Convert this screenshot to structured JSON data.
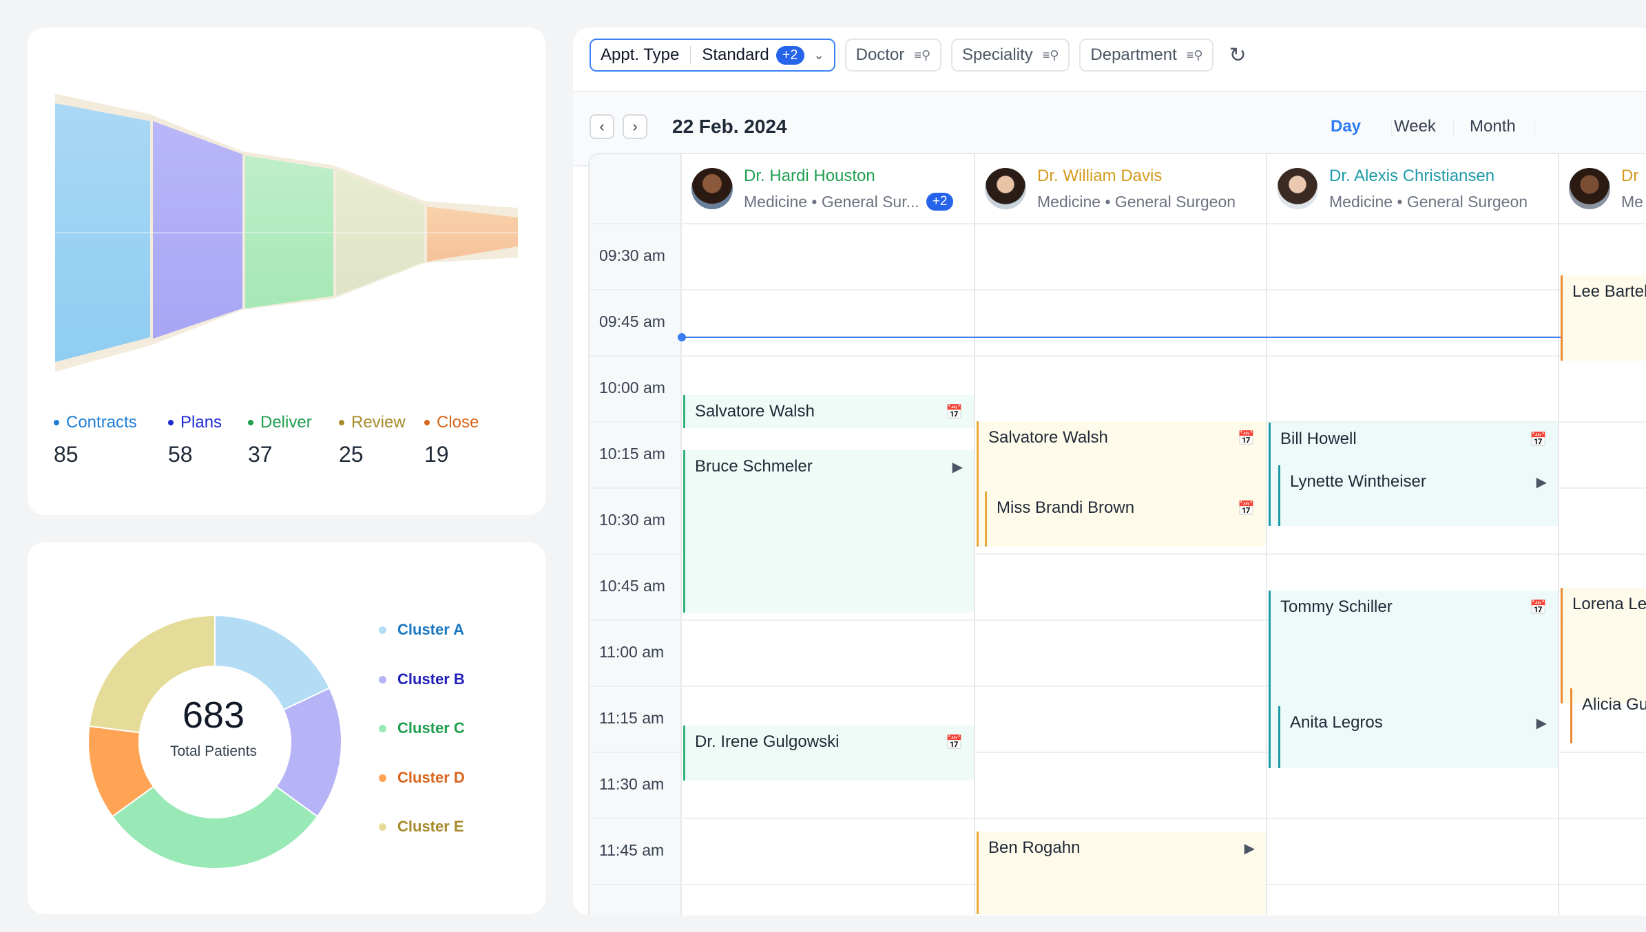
{
  "funnel": {
    "stages": [
      {
        "label": "Contracts",
        "value": "85",
        "color": "#1f7fd6"
      },
      {
        "label": "Plans",
        "value": "58",
        "color": "#1b2bd0"
      },
      {
        "label": "Deliver",
        "value": "37",
        "color": "#1f9e4f"
      },
      {
        "label": "Review",
        "value": "25",
        "color": "#a68a2b"
      },
      {
        "label": "Close",
        "value": "19",
        "color": "#d9641b"
      }
    ]
  },
  "donut": {
    "total": "683",
    "total_label": "Total Patients",
    "clusters": [
      {
        "label": "Cluster A",
        "value": 18,
        "color": "#b3dcf5",
        "text": "#1a78c2"
      },
      {
        "label": "Cluster B",
        "value": 17,
        "color": "#b6b4f7",
        "text": "#2020b8"
      },
      {
        "label": "Cluster C",
        "value": 30,
        "color": "#98e9b6",
        "text": "#1f9e4f"
      },
      {
        "label": "Cluster D",
        "value": 12,
        "color": "#ffa455",
        "text": "#d9641b"
      },
      {
        "label": "Cluster E",
        "value": 23,
        "color": "#e6dc9a",
        "text": "#a68a2b"
      }
    ]
  },
  "toolbar": {
    "appt_type_label": "Appt. Type",
    "appt_type_value": "Standard",
    "appt_type_more": "+2",
    "doctor": "Doctor",
    "speciality": "Speciality",
    "department": "Department"
  },
  "datebar": {
    "date": "22 Feb. 2024",
    "views": [
      "Day",
      "Week",
      "Month"
    ],
    "active_view": "Day"
  },
  "times": [
    "09:30 am",
    "09:45 am",
    "10:00 am",
    "10:15 am",
    "10:30 am",
    "10:45 am",
    "11:00 am",
    "11:15 am",
    "11:30 am",
    "11:45 am"
  ],
  "doctors": [
    {
      "name": "Dr. Hardi Houston",
      "spec": "Medicine • General Sur...",
      "more": "+2",
      "color": "#1f9e4f"
    },
    {
      "name": "Dr. William Davis",
      "spec": "Medicine • General Surgeon",
      "color": "#d49a1d"
    },
    {
      "name": "Dr. Alexis Christiansen",
      "spec": "Medicine • General Surgeon",
      "color": "#1d9aa8"
    },
    {
      "name": "Dr",
      "spec": "Me",
      "color": "#d49a1d"
    }
  ],
  "appointments": [
    {
      "name": "Salvatore Walsh"
    },
    {
      "name": "Bruce Schmeler"
    },
    {
      "name": "Dr. Irene Gulgowski"
    },
    {
      "name": "Salvatore Walsh"
    },
    {
      "name": "Miss Brandi Brown"
    },
    {
      "name": "Ben Rogahn"
    },
    {
      "name": "Bill Howell"
    },
    {
      "name": "Lynette Wintheiser"
    },
    {
      "name": "Tommy Schiller"
    },
    {
      "name": "Anita Legros"
    },
    {
      "name": "Lee Bartell"
    },
    {
      "name": "Lorena Les"
    },
    {
      "name": "Alicia Gu"
    }
  ]
}
